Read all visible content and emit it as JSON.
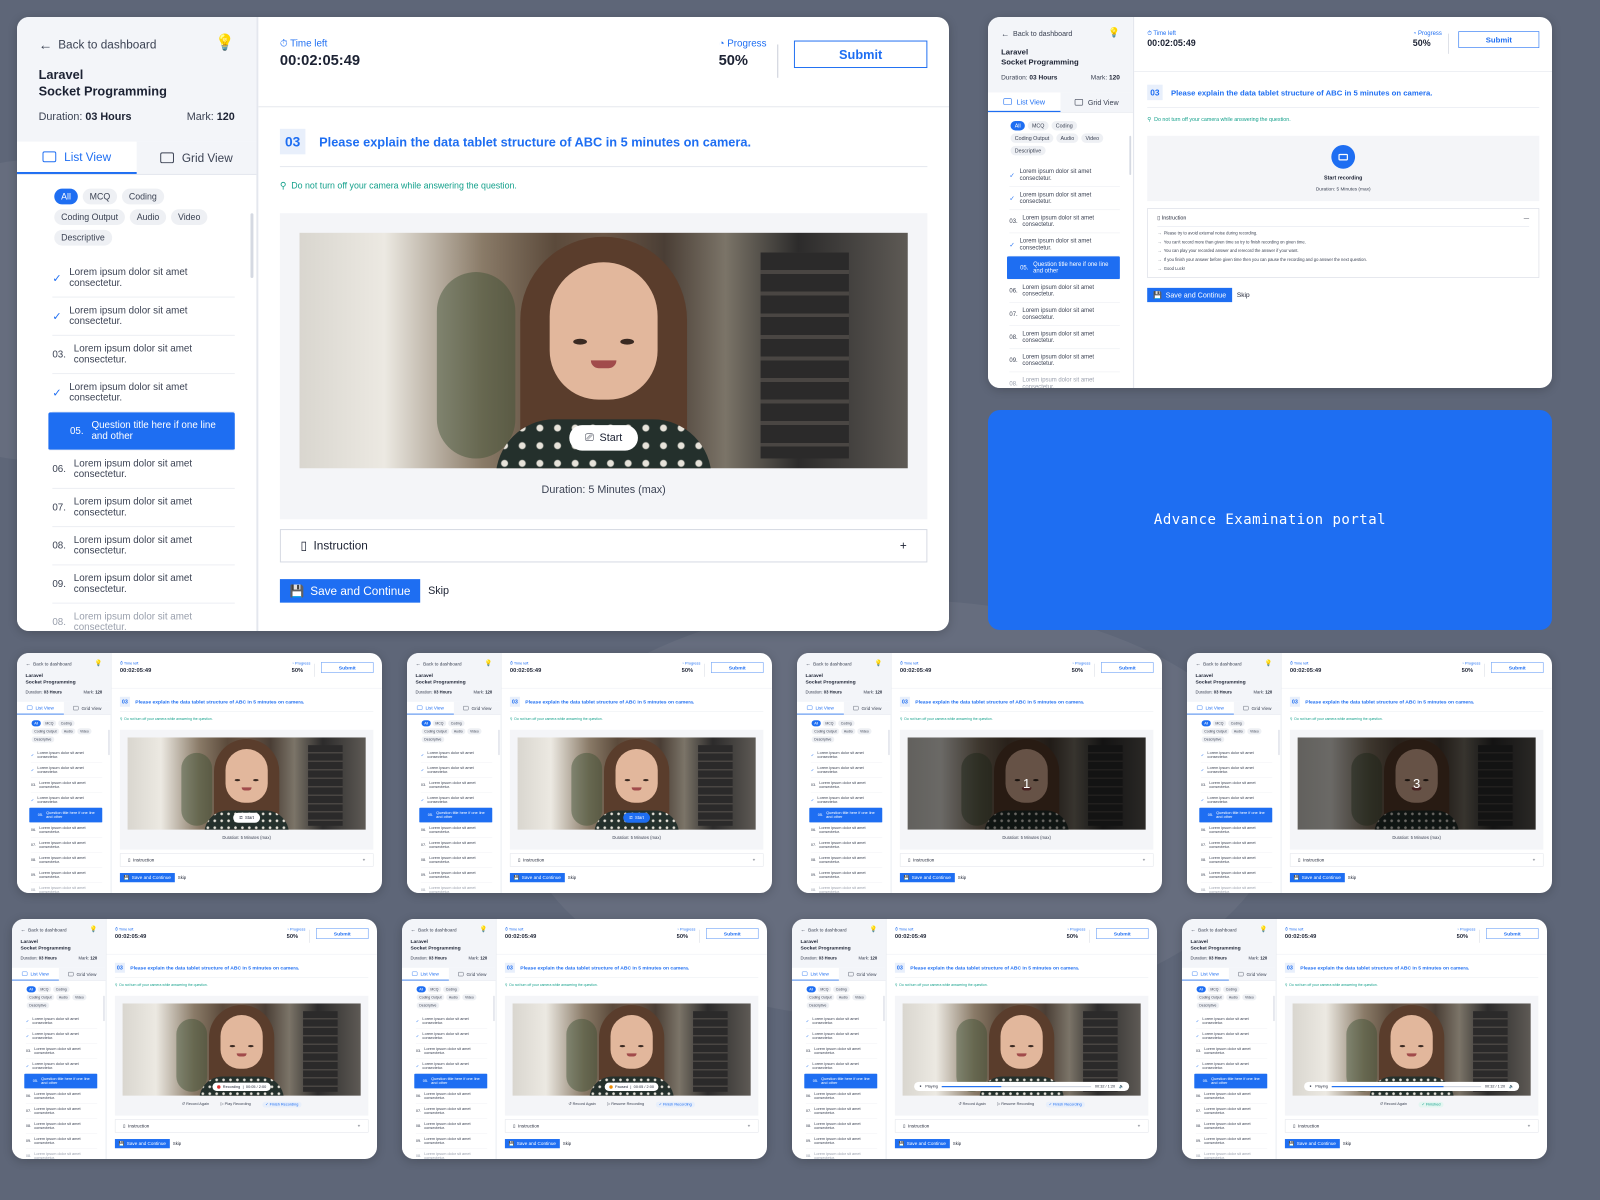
{
  "colors": {
    "accent": "#1e6ef2",
    "background": "#5e6678",
    "success": "#13a08b",
    "warning": "#f2b61d"
  },
  "sidebar": {
    "back_label": "Back to dashboard",
    "course_line1": "Laravel",
    "course_line2": "Socket Programming",
    "duration_label": "Duration:",
    "duration_value": "03 Hours",
    "mark_label": "Mark:",
    "mark_value": "120",
    "views": [
      {
        "label": "List View"
      },
      {
        "label": "Grid View"
      }
    ],
    "filters": [
      "All",
      "MCQ",
      "Coding",
      "Coding Output",
      "Audio",
      "Video",
      "Descriptive"
    ],
    "questions": [
      {
        "prefix": "✓",
        "text": "Lorem ipsum dolor sit amet consectetur."
      },
      {
        "prefix": "✓",
        "text": "Lorem ipsum dolor sit amet consectetur."
      },
      {
        "prefix": "03.",
        "text": "Lorem ipsum dolor sit amet consectetur."
      },
      {
        "prefix": "✓",
        "text": "Lorem ipsum dolor sit amet consectetur."
      },
      {
        "prefix": "05.",
        "text": "Question title here if one line and other"
      },
      {
        "prefix": "06.",
        "text": "Lorem ipsum dolor sit amet consectetur."
      },
      {
        "prefix": "07.",
        "text": "Lorem ipsum dolor sit amet consectetur."
      },
      {
        "prefix": "08.",
        "text": "Lorem ipsum dolor sit amet consectetur."
      },
      {
        "prefix": "09.",
        "text": "Lorem ipsum dolor sit amet consectetur."
      },
      {
        "prefix": "08.",
        "text": "Lorem ipsum dolor sit amet consectetur."
      }
    ]
  },
  "header": {
    "time_label": "Time left",
    "time_value": "00:02:05:49",
    "progress_label": "Progress",
    "progress_value": "50%",
    "submit_label": "Submit"
  },
  "question": {
    "number": "03",
    "text": "Please explain the data tablet structure of ABC in 5 minutes on camera.",
    "warning": "Do not turn off your camera while answering the question."
  },
  "recorder": {
    "start_label": "Start",
    "duration_text": "Duration:  5 Minutes (max)",
    "start_recording_label": "Start recording",
    "duration_small": "Duration:  5 Minutes (max)",
    "countdown_1": "1",
    "countdown_3": "3",
    "recording_label": "Recording",
    "recording_time": "00:05 / 2:00",
    "paused_label": "Paused",
    "paused_time": "00:05 / 2:00",
    "playing_label": "Playing",
    "playing_time": "00:32 / 1:20",
    "record_again": "Record Again",
    "play_recording": "Play Recording",
    "finish_recording": "Finish Recording",
    "resume_recording": "Resume Recording",
    "finished": "Finished"
  },
  "instruction": {
    "label": "Instruction",
    "lines": [
      "Please try to avoid external noise during recording.",
      "You can't record more than given time so try to finish recording on given time.",
      "You can play your recorded answer and rerecord the answer if your want.",
      "If you finish your answer before given time then you can pause the recording and go answer the next question.",
      "Good Luck!"
    ]
  },
  "actions": {
    "save_label": "Save and Continue",
    "skip_label": "Skip"
  },
  "banner": {
    "title": "Advance Examination portal"
  }
}
